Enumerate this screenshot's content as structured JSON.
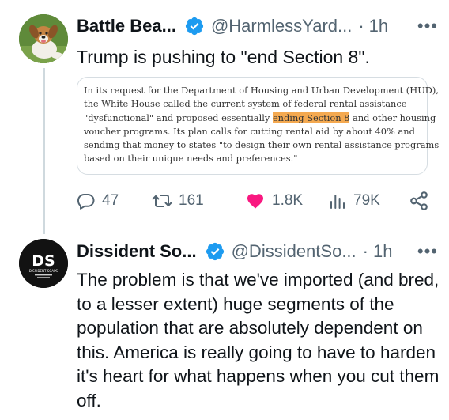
{
  "tweet1": {
    "name": "Battle Bea...",
    "handle": "@HarmlessYard...",
    "separator": "·",
    "time": "1h",
    "more": "•••",
    "text": "Trump is pushing to \"end Section 8\".",
    "quote_lines": [
      {
        "before": "In its request for the Department of Housing and Urban Development (HUD),",
        "highlight": "",
        "after": ""
      },
      {
        "before": "the White House called the current system of federal rental assistance",
        "highlight": "",
        "after": ""
      },
      {
        "before": "\"dysfunctional\" and proposed essentially ",
        "highlight": "ending Section 8",
        "after": " and other housing"
      },
      {
        "before": "voucher programs. Its plan calls for cutting rental aid by about 40% and",
        "highlight": "",
        "after": ""
      },
      {
        "before": "sending that money to states \"to design their own rental assistance programs",
        "highlight": "",
        "after": ""
      },
      {
        "before": "based on their unique needs and preferences.\"",
        "highlight": "",
        "after": ""
      }
    ],
    "highlight_color": "#f4a950",
    "stats": {
      "replies": "47",
      "retweets": "161",
      "likes": "1.8K",
      "views": "79K"
    },
    "like_color": "#f91880"
  },
  "tweet2": {
    "name": "Dissident So...",
    "handle": "@DissidentSo...",
    "separator": "·",
    "time": "1h",
    "more": "•••",
    "avatar_text": "DS",
    "avatar_subtext": "DISSIDENT SOAPS",
    "text": "The problem is that we've imported (and bred, to a lesser extent) huge segments of the population that are absolutely dependent on this. America is really going to have to harden it's heart for what happens when you cut them off."
  },
  "colors": {
    "verified": "#1d9bf0",
    "secondary_text": "#536471"
  }
}
